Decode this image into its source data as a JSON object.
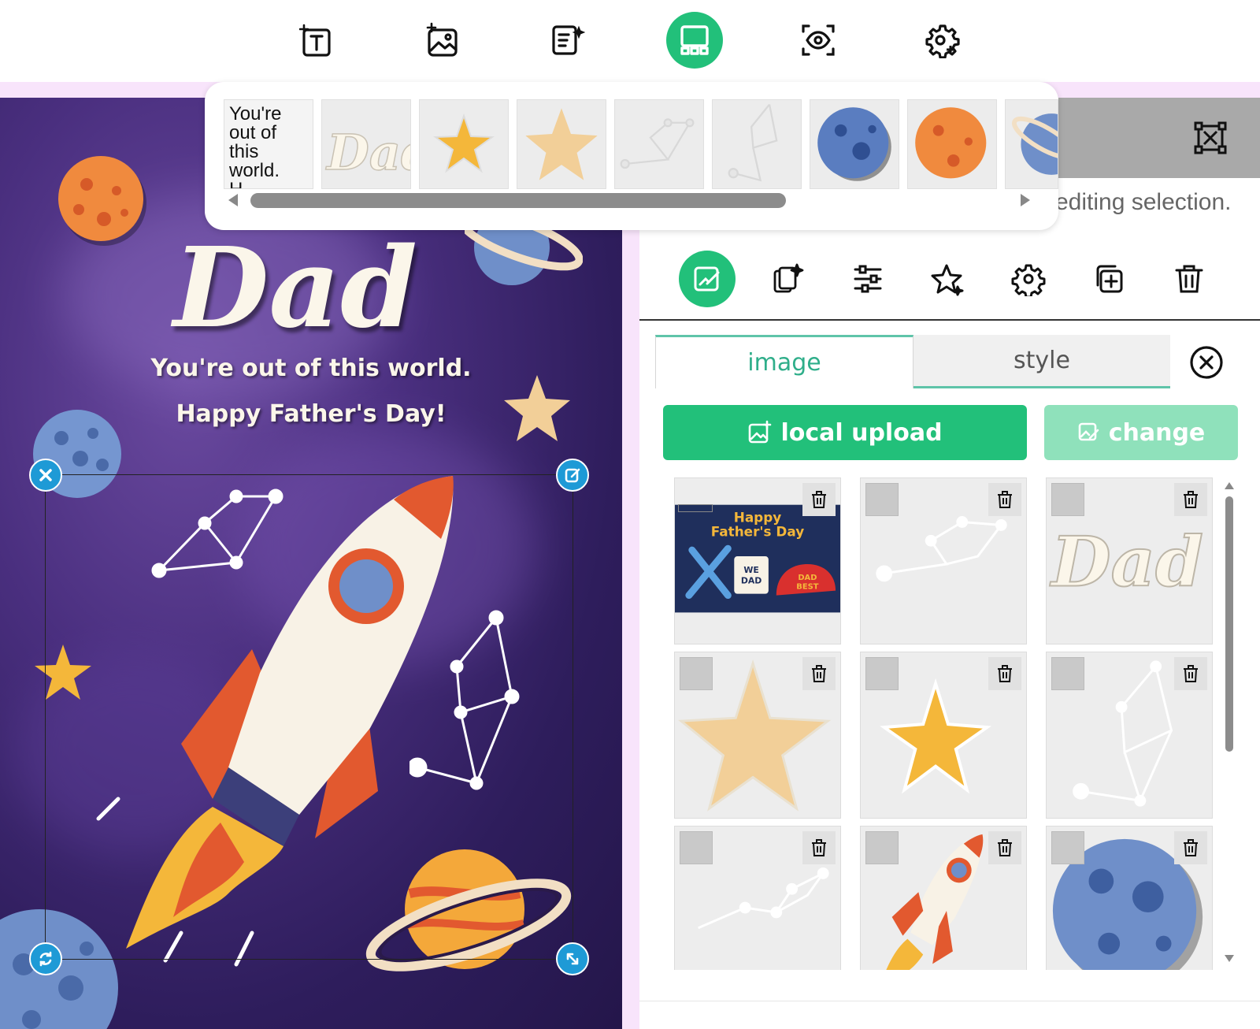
{
  "toolbar": {
    "buttons": [
      {
        "name": "add-text",
        "icon": "text-plus-icon",
        "active": false
      },
      {
        "name": "add-image",
        "icon": "image-plus-icon",
        "active": false
      },
      {
        "name": "ai-write",
        "icon": "ai-edit-icon",
        "active": false
      },
      {
        "name": "layout",
        "icon": "layout-icon",
        "active": true
      },
      {
        "name": "preview",
        "icon": "eye-icon",
        "active": false
      },
      {
        "name": "settings",
        "icon": "gear-plus-icon",
        "active": false
      }
    ],
    "accent": "#22c07a"
  },
  "card": {
    "title": "Dad",
    "line1": "You're out of this world.",
    "line2": "Happy Father's Day!"
  },
  "strip": {
    "text_thumb": "You're out of this world. H...",
    "items": [
      "text",
      "dad-lettering",
      "yellow-star",
      "beige-star",
      "constellation",
      "constellation-2",
      "blue-planet",
      "orange-planet",
      "ringed-planet"
    ]
  },
  "panel": {
    "hint": "editing selection.",
    "tools": [
      "edit-icon",
      "ai-copy-icon",
      "sliders-icon",
      "star-icon",
      "gear-icon",
      "duplicate-icon",
      "trash-icon"
    ],
    "tabs": {
      "image": "image",
      "style": "style"
    },
    "upload_label": "local upload",
    "change_label": "change",
    "grid_caption": {
      "line1": "Happy",
      "line2": "Father's Day",
      "mug": "WE DAD",
      "cap": "DAD BEST"
    }
  }
}
